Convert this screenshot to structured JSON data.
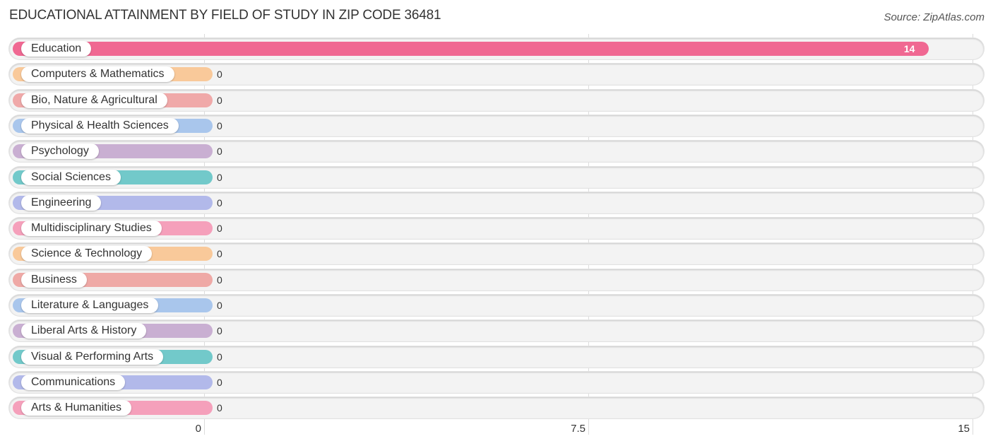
{
  "title": "EDUCATIONAL ATTAINMENT BY FIELD OF STUDY IN ZIP CODE 36481",
  "source": "Source: ZipAtlas.com",
  "chart_data": {
    "type": "bar",
    "orientation": "horizontal",
    "title": "EDUCATIONAL ATTAINMENT BY FIELD OF STUDY IN ZIP CODE 36481",
    "xlabel": "",
    "ylabel": "",
    "xlim": [
      0,
      15
    ],
    "xticks": [
      "0",
      "7.5",
      "15"
    ],
    "grid": true,
    "categories": [
      "Education",
      "Computers & Mathematics",
      "Bio, Nature & Agricultural",
      "Physical & Health Sciences",
      "Psychology",
      "Social Sciences",
      "Engineering",
      "Multidisciplinary Studies",
      "Science & Technology",
      "Business",
      "Literature & Languages",
      "Liberal Arts & History",
      "Visual & Performing Arts",
      "Communications",
      "Arts & Humanities"
    ],
    "values": [
      14,
      0,
      0,
      0,
      0,
      0,
      0,
      0,
      0,
      0,
      0,
      0,
      0,
      0,
      0
    ],
    "value_labels": [
      "14",
      "0",
      "0",
      "0",
      "0",
      "0",
      "0",
      "0",
      "0",
      "0",
      "0",
      "0",
      "0",
      "0",
      "0"
    ],
    "colors": [
      "#f06892",
      "#f9c99a",
      "#f0a9a9",
      "#a9c6ec",
      "#c9afd2",
      "#72c9ca",
      "#b2b9ea",
      "#f5a0bb",
      "#f9c99a",
      "#efa9a6",
      "#a9c6ec",
      "#c9afd2",
      "#72c9ca",
      "#b2b9ea",
      "#f5a0bb"
    ]
  }
}
